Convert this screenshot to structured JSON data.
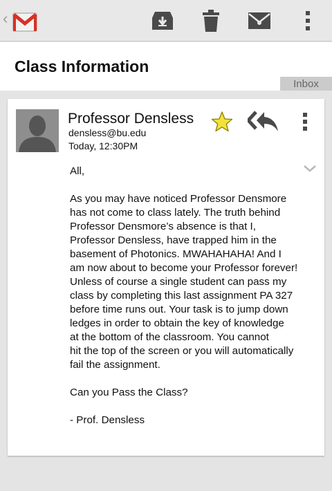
{
  "actionbar": {
    "back_icon": "chevron-left-icon",
    "app_icon": "gmail-logo-icon",
    "actions": [
      {
        "name": "archive",
        "icon": "archive-icon"
      },
      {
        "name": "delete",
        "icon": "trash-icon"
      },
      {
        "name": "mark-unread",
        "icon": "envelope-icon"
      },
      {
        "name": "overflow",
        "icon": "overflow-menu-icon"
      }
    ]
  },
  "header": {
    "subject": "Class Information",
    "label": "Inbox"
  },
  "message": {
    "sender_name": "Professor Densless",
    "sender_email": "densless@bu.edu",
    "time": "Today, 12:30PM",
    "starred": true,
    "greeting": "All,",
    "body_lines": [
      "As you may have noticed Professor Densmore",
      "has not come to class lately. The truth behind",
      "Professor Densmore’s absence is that I,",
      "Professor Densless, have trapped him in the",
      "basement of Photonics. MWAHAHAHA! And I",
      "am now about to become your Professor forever!",
      "Unless of course a single student can pass my",
      "class by completing this last assignment PA 327",
      "before time runs out. Your task is to jump down",
      "ledges in order to obtain the key of knowledge",
      "at the bottom of the classroom. You cannot",
      "hit the top of the screen or you will automatically",
      "fail the assignment."
    ],
    "question": "Can you Pass the Class?",
    "signoff": "- Prof. Densless"
  },
  "colors": {
    "star": "#f3e23a",
    "gmail_red": "#d93025",
    "icon_gray": "#4a4a4a"
  }
}
